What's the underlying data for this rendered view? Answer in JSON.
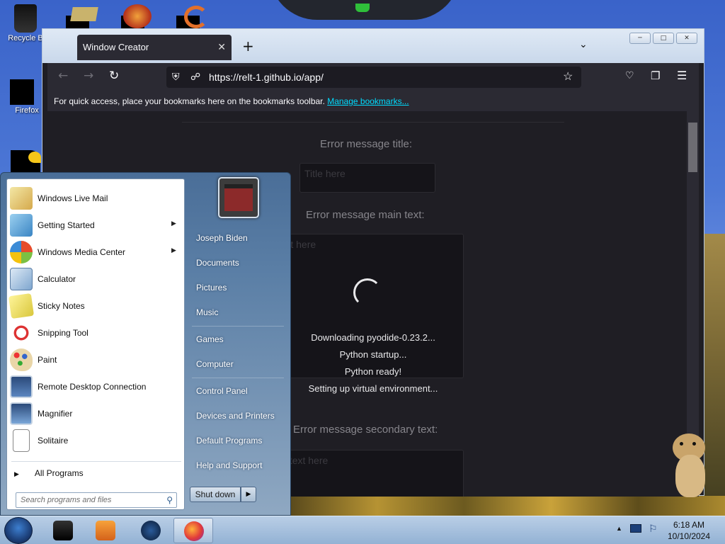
{
  "desktop": {
    "icons": [
      {
        "label": "Recycle B",
        "icon": "recycle-bin-icon"
      },
      {
        "label": "Firefox",
        "icon": "firefox-icon"
      }
    ]
  },
  "browser": {
    "tab_title": "Window Creator",
    "tab_close": "✕",
    "new_tab": "+",
    "list_tabs": "⌄",
    "nav": {
      "back": "←",
      "forward": "→",
      "reload": "↻"
    },
    "url": "https://relt-1.github.io/app/",
    "bookmarks_text": "For quick access, place your bookmarks here on the bookmarks toolbar.",
    "bookmarks_link": "Manage bookmarks...",
    "page": {
      "title_label": "Error message title:",
      "title_placeholder": "Title here",
      "main_label": "Error message main text:",
      "main_placeholder": "Main error text here",
      "secondary_label": "Error message secondary text:",
      "secondary_placeholder": "Second error text here",
      "loading_lines": [
        "Downloading pyodide-0.23.2...",
        "Python startup...",
        "Python ready!",
        "Setting up virtual environment..."
      ]
    }
  },
  "start_menu": {
    "pinned": [
      {
        "label": "Windows Live Mail",
        "icon": "mail-icon",
        "submenu": false
      },
      {
        "label": "Getting Started",
        "icon": "getting-started-icon",
        "submenu": true
      },
      {
        "label": "Windows Media Center",
        "icon": "media-center-icon",
        "submenu": true
      },
      {
        "label": "Calculator",
        "icon": "calculator-icon",
        "submenu": false
      },
      {
        "label": "Sticky Notes",
        "icon": "sticky-notes-icon",
        "submenu": false
      },
      {
        "label": "Snipping Tool",
        "icon": "scissors-icon",
        "submenu": false
      },
      {
        "label": "Paint",
        "icon": "paint-palette-icon",
        "submenu": false
      },
      {
        "label": "Remote Desktop Connection",
        "icon": "remote-desktop-icon",
        "submenu": false
      },
      {
        "label": "Magnifier",
        "icon": "magnifier-icon",
        "submenu": false
      },
      {
        "label": "Solitaire",
        "icon": "cards-icon",
        "submenu": false
      }
    ],
    "all_programs": "All Programs",
    "search_placeholder": "Search programs and files",
    "right_items": [
      "Joseph Biden",
      "Documents",
      "Pictures",
      "Music",
      "Games",
      "Computer",
      "Control Panel",
      "Devices and Printers",
      "Default Programs",
      "Help and Support"
    ],
    "shutdown": "Shut down"
  },
  "taskbar": {
    "clock_time": "6:18 AM",
    "clock_date": "10/10/2024"
  },
  "colors": {
    "firefox_dark": "#2b2a33",
    "link": "#00ddff",
    "taskbar": "#93b2d4"
  }
}
